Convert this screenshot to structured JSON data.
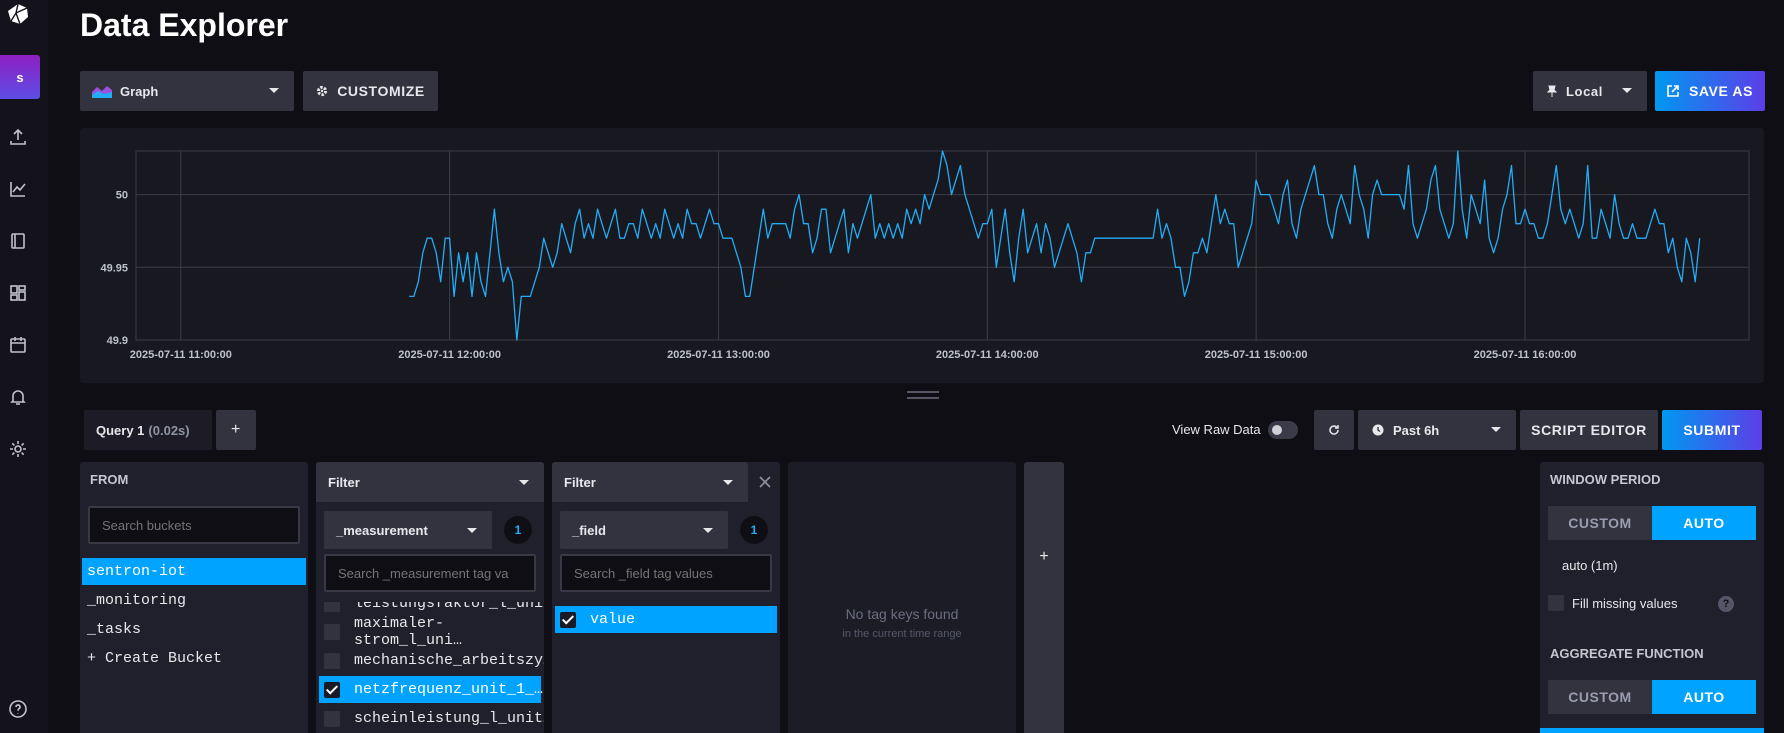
{
  "page": {
    "title": "Data Explorer"
  },
  "nav": {
    "avatar_letter": "s"
  },
  "toolbar": {
    "visualization": "Graph",
    "customize_label": "CUSTOMIZE",
    "timezone": "Local",
    "save_as_label": "SAVE AS"
  },
  "chart_data": {
    "type": "line",
    "x": [
      "2025-07-11 10:50",
      "2025-07-11 16:50"
    ],
    "ylim": [
      49.9,
      50.03
    ],
    "y_ticks": [
      "50",
      "49.95",
      "49.9"
    ],
    "x_ticks": [
      "2025-07-11 11:00:00",
      "2025-07-11 12:00:00",
      "2025-07-11 13:00:00",
      "2025-07-11 14:00:00",
      "2025-07-11 15:00:00",
      "2025-07-11 16:00:00"
    ],
    "series": [
      {
        "color": "#22adf6",
        "start_minute": 61,
        "step_minutes": 1,
        "values": [
          49.93,
          49.93,
          49.94,
          49.96,
          49.97,
          49.97,
          49.96,
          49.94,
          49.97,
          49.97,
          49.93,
          49.96,
          49.94,
          49.96,
          49.93,
          49.96,
          49.94,
          49.93,
          49.96,
          49.99,
          49.96,
          49.94,
          49.95,
          49.94,
          49.9,
          49.93,
          49.93,
          49.93,
          49.94,
          49.95,
          49.97,
          49.96,
          49.95,
          49.96,
          49.98,
          49.97,
          49.96,
          49.98,
          49.99,
          49.97,
          49.98,
          49.97,
          49.99,
          49.98,
          49.97,
          49.98,
          49.99,
          49.97,
          49.97,
          49.98,
          49.98,
          49.97,
          49.99,
          49.98,
          49.97,
          49.98,
          49.97,
          49.99,
          49.98,
          49.97,
          49.98,
          49.97,
          49.99,
          49.98,
          49.98,
          49.97,
          49.98,
          49.99,
          49.98,
          49.98,
          49.97,
          49.97,
          49.97,
          49.96,
          49.95,
          49.93,
          49.93,
          49.95,
          49.97,
          49.99,
          49.97,
          49.98,
          49.98,
          49.98,
          49.98,
          49.97,
          49.99,
          50.0,
          49.98,
          49.98,
          49.96,
          49.97,
          49.99,
          49.99,
          49.96,
          49.97,
          49.98,
          49.99,
          49.96,
          49.98,
          49.97,
          49.98,
          49.99,
          50.0,
          49.97,
          49.98,
          49.97,
          49.98,
          49.97,
          49.98,
          49.97,
          49.99,
          49.98,
          49.99,
          49.98,
          50.0,
          49.99,
          50.0,
          50.01,
          50.03,
          50.02,
          50.0,
          50.01,
          50.02,
          50.0,
          49.99,
          49.98,
          49.97,
          49.98,
          49.98,
          49.99,
          49.95,
          49.97,
          49.99,
          49.96,
          49.94,
          49.97,
          49.99,
          49.96,
          49.97,
          49.98,
          49.96,
          49.98,
          49.97,
          49.95,
          49.96,
          49.97,
          49.98,
          49.97,
          49.96,
          49.94,
          49.96,
          49.96,
          49.97,
          49.97,
          49.97,
          49.97,
          49.97,
          49.97,
          49.97,
          49.97,
          49.97,
          49.97,
          49.97,
          49.97,
          49.97,
          49.97,
          49.99,
          49.97,
          49.98,
          49.97,
          49.95,
          49.95,
          49.93,
          49.94,
          49.96,
          49.96,
          49.97,
          49.96,
          49.98,
          50.0,
          49.98,
          49.99,
          49.98,
          49.98,
          49.95,
          49.96,
          49.97,
          49.98,
          50.01,
          50.0,
          50.0,
          50.0,
          49.99,
          49.98,
          50.0,
          50.01,
          49.98,
          49.97,
          49.99,
          50.0,
          50.01,
          50.02,
          50.0,
          50.0,
          49.98,
          49.97,
          49.99,
          50.0,
          49.99,
          49.98,
          50.02,
          50.0,
          49.99,
          49.97,
          50.0,
          50.01,
          50.0,
          50.0,
          50.0,
          50.0,
          50.0,
          49.99,
          50.02,
          49.98,
          49.97,
          49.98,
          49.99,
          50.01,
          50.02,
          49.99,
          49.98,
          49.97,
          49.98,
          50.03,
          49.99,
          49.97,
          50.0,
          49.99,
          49.98,
          50.01,
          49.97,
          49.96,
          49.97,
          49.99,
          50.0,
          50.02,
          49.98,
          49.98,
          49.99,
          49.98,
          49.98,
          49.97,
          49.97,
          49.98,
          50.0,
          50.02,
          49.99,
          49.98,
          49.99,
          49.98,
          49.97,
          49.98,
          50.02,
          49.97,
          49.97,
          49.99,
          49.98,
          49.97,
          50.0,
          49.98,
          49.97,
          49.97,
          49.98,
          49.97,
          49.97,
          49.97,
          49.98,
          49.99,
          49.98,
          49.98,
          49.96,
          49.97,
          49.95,
          49.94,
          49.97,
          49.96,
          49.94,
          49.97
        ]
      }
    ]
  },
  "query": {
    "tab_label": "Query 1",
    "tab_time": "(0.02s)",
    "add_label": "+",
    "view_raw_label": "View Raw Data",
    "time_range": "Past 6h",
    "script_editor_label": "SCRIPT EDITOR",
    "submit_label": "SUBMIT"
  },
  "from": {
    "heading": "FROM",
    "search_placeholder": "Search buckets",
    "buckets": [
      "sentron-iot",
      "_monitoring",
      "_tasks",
      "+ Create Bucket"
    ]
  },
  "filter1": {
    "heading": "Filter",
    "key": "_measurement",
    "count": "1",
    "search_placeholder": "Search _measurement tag va",
    "values": [
      "leistungsfaktor_l_unit_",
      "maximaler-strom_l_uni…",
      "mechanische_arbeitszy…",
      "netzfrequenz_unit_1_…",
      "scheinleistung_l_unit…"
    ]
  },
  "filter2": {
    "heading": "Filter",
    "key": "_field",
    "count": "1",
    "search_placeholder": "Search _field tag values",
    "values": [
      "value"
    ]
  },
  "empty_panel": {
    "title": "No tag keys found",
    "subtitle": "in the current time range"
  },
  "add_filter_label": "+",
  "options": {
    "window_heading": "WINDOW PERIOD",
    "custom_label": "CUSTOM",
    "auto_label": "AUTO",
    "auto_value": "auto (1m)",
    "fill_missing_label": "Fill missing values",
    "help_label": "?",
    "aggregate_heading": "AGGREGATE FUNCTION"
  }
}
